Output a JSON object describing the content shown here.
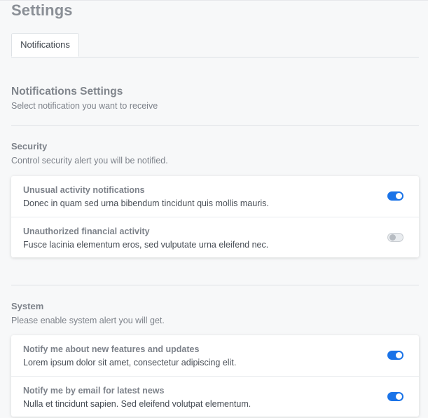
{
  "page": {
    "title": "Settings"
  },
  "tabs": [
    {
      "label": "Notifications",
      "active": true
    }
  ],
  "notifications": {
    "title": "Notifications Settings",
    "subtitle": "Select notification you want to receive"
  },
  "security": {
    "title": "Security",
    "subtitle": "Control security alert you will be notified.",
    "items": [
      {
        "title": "Unusual activity notifications",
        "description": "Donec in quam sed urna bibendum tincidunt quis mollis mauris.",
        "enabled": true
      },
      {
        "title": "Unauthorized financial activity",
        "description": "Fusce lacinia elementum eros, sed vulputate urna eleifend nec.",
        "enabled": false
      }
    ]
  },
  "system": {
    "title": "System",
    "subtitle": "Please enable system alert you will get.",
    "items": [
      {
        "title": "Notify me about new features and updates",
        "description": "Lorem ipsum dolor sit amet, consectetur adipiscing elit.",
        "enabled": true
      },
      {
        "title": "Notify me by email for latest news",
        "description": "Nulla et tincidunt sapien. Sed eleifend volutpat elementum.",
        "enabled": true
      }
    ]
  },
  "colors": {
    "accent": "#1a73e8",
    "toggle_off": "#e9ecef",
    "page_background": "#f7f8f9"
  }
}
